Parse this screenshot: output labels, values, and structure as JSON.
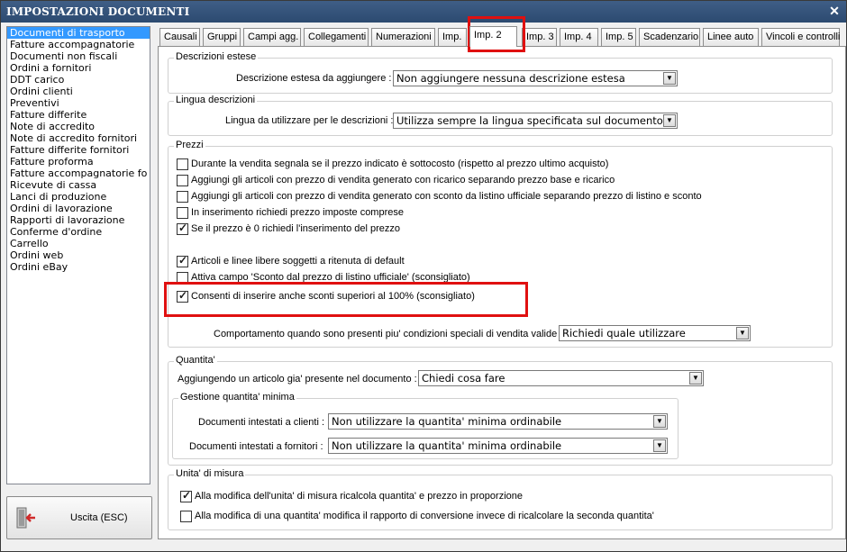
{
  "window": {
    "title": "IMPOSTAZIONI DOCUMENTI",
    "close_glyph": "✕"
  },
  "sidebar": {
    "items": [
      "Documenti di trasporto",
      "Fatture accompagnatorie",
      "Documenti non fiscali",
      "Ordini a fornitori",
      "DDT carico",
      "Ordini clienti",
      "Preventivi",
      "Fatture differite",
      "Note di accredito",
      "Note di accredito fornitori",
      "Fatture differite fornitori",
      "Fatture proforma",
      "Fatture accompagnatorie fo",
      "Ricevute di cassa",
      "Lanci di produzione",
      "Ordini di lavorazione",
      "Rapporti di lavorazione",
      "Conferme d'ordine",
      "Carrello",
      "Ordini web",
      "Ordini eBay"
    ],
    "selected_index": 0
  },
  "exit_button": {
    "label": "Uscita (ESC)"
  },
  "tabs": [
    "Causali",
    "Gruppi",
    "Campi agg.",
    "Collegamenti",
    "Numerazioni",
    "Imp.",
    "Imp. 2",
    "Imp. 3",
    "Imp. 4",
    "Imp. 5",
    "Scadenzario",
    "Linee auto",
    "Vincoli e controlli"
  ],
  "active_tab": "Imp. 2",
  "descrizioni": {
    "group_label": "Descrizioni estese",
    "field_label": "Descrizione estesa da aggiungere :",
    "value": "Non aggiungere nessuna descrizione estesa"
  },
  "lingua": {
    "group_label": "Lingua descrizioni",
    "field_label": "Lingua da utilizzare per le descrizioni :",
    "value": "Utilizza sempre la lingua specificata sul documento"
  },
  "prezzi": {
    "group_label": "Prezzi",
    "checkboxes": [
      {
        "label": "Durante la vendita segnala se il prezzo indicato è sottocosto (rispetto al prezzo ultimo acquisto)",
        "checked": false
      },
      {
        "label": "Aggiungi gli articoli con prezzo di vendita generato con ricarico separando prezzo base e ricarico",
        "checked": false
      },
      {
        "label": "Aggiungi gli articoli con prezzo di vendita generato con sconto da listino ufficiale separando prezzo di listino e sconto",
        "checked": false
      },
      {
        "label": "In inserimento richiedi prezzo imposte comprese",
        "checked": false
      },
      {
        "label": "Se il prezzo è 0 richiedi l'inserimento del prezzo",
        "checked": true
      },
      {
        "label": "Articoli e linee libere soggetti a ritenuta di default",
        "checked": true
      },
      {
        "label": "Attiva campo 'Sconto dal prezzo di listino ufficiale' (sconsigliato)",
        "checked": false
      },
      {
        "label": "Consenti di inserire anche sconti superiori al 100% (sconsigliato)",
        "checked": true
      }
    ],
    "condizioni_label": "Comportamento quando sono presenti piu' condizioni speciali di vendita valide :",
    "condizioni_value": "Richiedi quale utilizzare"
  },
  "quantita": {
    "group_label": "Quantita'",
    "field_label": "Aggiungendo un articolo gia' presente nel documento :",
    "value": "Chiedi cosa fare",
    "minima": {
      "group_label": "Gestione quantita' minima",
      "clienti_label": "Documenti intestati a clienti :",
      "clienti_value": "Non utilizzare la quantita' minima ordinabile",
      "fornitori_label": "Documenti intestati a fornitori :",
      "fornitori_value": "Non utilizzare la quantita' minima ordinabile"
    }
  },
  "unita": {
    "group_label": "Unita' di misura",
    "checkboxes": [
      {
        "label": "Alla modifica dell'unita' di misura ricalcola quantita' e prezzo in proporzione",
        "checked": true
      },
      {
        "label": "Alla modifica di una quantita' modifica il rapporto di conversione invece di ricalcolare la seconda quantita'",
        "checked": false
      }
    ]
  },
  "colors": {
    "highlight": "#e01010",
    "selection": "#3399ff",
    "titlebar": "#2c4a70"
  }
}
